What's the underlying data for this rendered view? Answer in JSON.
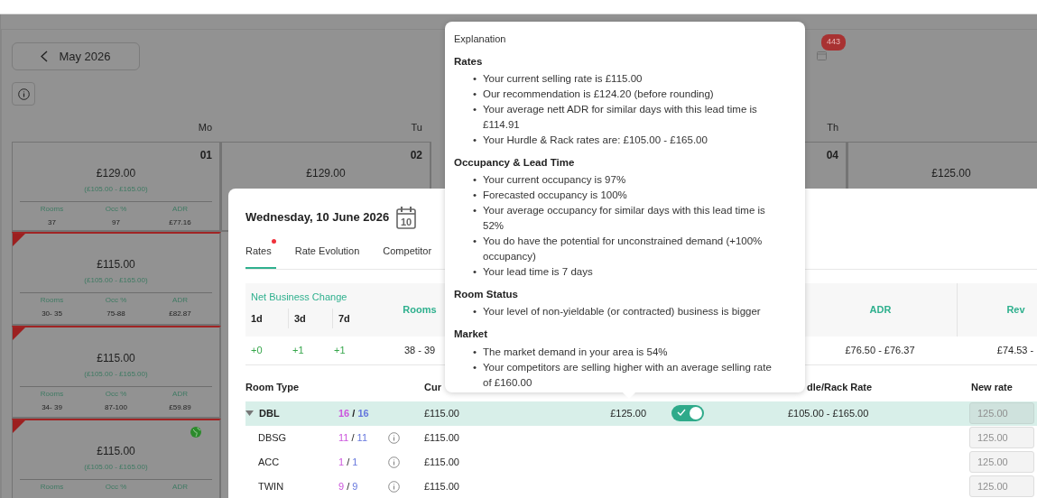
{
  "calendar": {
    "month_button": "May 2026",
    "badge": "443",
    "weekdays": [
      {
        "label": "Mo"
      },
      {
        "label": "Tu"
      },
      {
        "label": "Th"
      }
    ],
    "rows": [
      [
        {
          "date": "01",
          "price": "£129.00",
          "range": "(£105.00 - £165.00)",
          "flagged": false,
          "globe": false,
          "stats": [
            {
              "label": "Rooms",
              "value": "37"
            },
            {
              "label": "Occ %",
              "value": "97"
            },
            {
              "label": "ADR",
              "value": "£77.16"
            }
          ]
        },
        {
          "date": "02",
          "price": "£129.00"
        },
        {
          "date": "04"
        },
        {
          "price": "£125.00"
        }
      ],
      [
        {
          "price": "£115.00",
          "range": "(£105.00 - £165.00)",
          "flagged": true,
          "globe": false,
          "stats": [
            {
              "label": "Rooms",
              "value": "30- 35"
            },
            {
              "label": "Occ %",
              "value": "75-88"
            },
            {
              "label": "ADR",
              "value": "£82.87"
            }
          ]
        }
      ],
      [
        {
          "price": "£115.00",
          "range": "(£105.00 - £165.00)",
          "flagged": true,
          "globe": false,
          "stats": [
            {
              "label": "Rooms",
              "value": "34- 39"
            },
            {
              "label": "Occ %",
              "value": "87-100"
            },
            {
              "label": "ADR",
              "value": "£59.89"
            }
          ]
        }
      ],
      [
        {
          "price": "£115.00",
          "range": "(£105.00 - £165.00)",
          "flagged": true,
          "globe": true,
          "stats": [
            {
              "label": "Rooms"
            },
            {
              "label": "Occ %"
            },
            {
              "label": "ADR"
            }
          ]
        }
      ]
    ]
  },
  "day_panel": {
    "title": "Wednesday, 10 June 2026",
    "calendar_icon_day": "10",
    "tabs": [
      {
        "label": "Rates",
        "selected": true,
        "notification": true
      },
      {
        "label": "Rate Evolution",
        "selected": false,
        "notification": false
      },
      {
        "label": "Competitor",
        "selected": false,
        "notification": false
      }
    ],
    "net_business": {
      "title": "Net Business Change",
      "periods": [
        {
          "label": "1d",
          "value": "+0"
        },
        {
          "label": "3d",
          "value": "+1"
        },
        {
          "label": "7d",
          "value": "+1"
        }
      ],
      "metrics": [
        {
          "label": "Rooms",
          "value": "38 - 39"
        },
        {
          "label": "ADR",
          "value": "£76.50 - £76.37"
        },
        {
          "label": "Rev",
          "value": "£74.53 -"
        }
      ]
    },
    "room_table": {
      "columns": [
        {
          "label": "Room Type"
        },
        {
          "label": "Cur"
        },
        {
          "label": "dle/Rack Rate"
        },
        {
          "label": "New rate"
        }
      ],
      "rows": [
        {
          "kind": "group",
          "name": "DBL",
          "expanded": true,
          "availability": [
            "16",
            "/",
            "16"
          ],
          "current": "£115.00",
          "recommended": "£125.00",
          "auto": true,
          "hurdle_rack": "£105.00 - £165.00",
          "new_rate_placeholder": "125.00"
        },
        {
          "kind": "room",
          "name": "DBSG",
          "availability": [
            "11",
            "/",
            "11"
          ],
          "current": "£115.00",
          "new_rate_placeholder": "125.00"
        },
        {
          "kind": "room",
          "name": "ACC",
          "availability": [
            "1",
            "/",
            "1"
          ],
          "current": "£115.00",
          "new_rate_placeholder": "125.00"
        },
        {
          "kind": "room",
          "name": "TWIN",
          "availability": [
            "9",
            "/",
            "9"
          ],
          "current": "£115.00",
          "new_rate_placeholder": "125.00"
        }
      ]
    }
  },
  "explanation": {
    "title": "Explanation",
    "sections": [
      {
        "heading": "Rates",
        "items": [
          {
            "bullet": "•",
            "text": "Your current selling rate is £115.00"
          },
          {
            "bullet": "•",
            "text": "Our recommendation is £124.20 (before rounding)"
          },
          {
            "bullet": "•",
            "text": "Your average nett ADR for similar days with this lead time is £114.91"
          },
          {
            "bullet": "•",
            "text": "Your Hurdle & Rack rates are: £105.00 - £165.00"
          }
        ]
      },
      {
        "heading": "Occupancy & Lead Time",
        "items": [
          {
            "bullet": "•",
            "text": "Your current occupancy is 97%"
          },
          {
            "bullet": "•",
            "text": "Forecasted occupancy is 100%"
          },
          {
            "bullet": "•",
            "text": "Your average occupancy for similar days with this lead time is 52%"
          },
          {
            "bullet": "•",
            "text": "You do have the potential for unconstrained demand (+100% occupancy)"
          },
          {
            "bullet": "•",
            "text": "Your lead time is 7 days"
          }
        ]
      },
      {
        "heading": "Room Status",
        "items": [
          {
            "bullet": "•",
            "text": "Your level of non-yieldable (or contracted) business is bigger"
          }
        ]
      },
      {
        "heading": "Market",
        "items": [
          {
            "bullet": "•",
            "text": "The market demand in your area is 54%"
          },
          {
            "bullet": "•",
            "text": "Your competitors are selling higher with an average selling rate of £160.00"
          }
        ]
      }
    ]
  }
}
